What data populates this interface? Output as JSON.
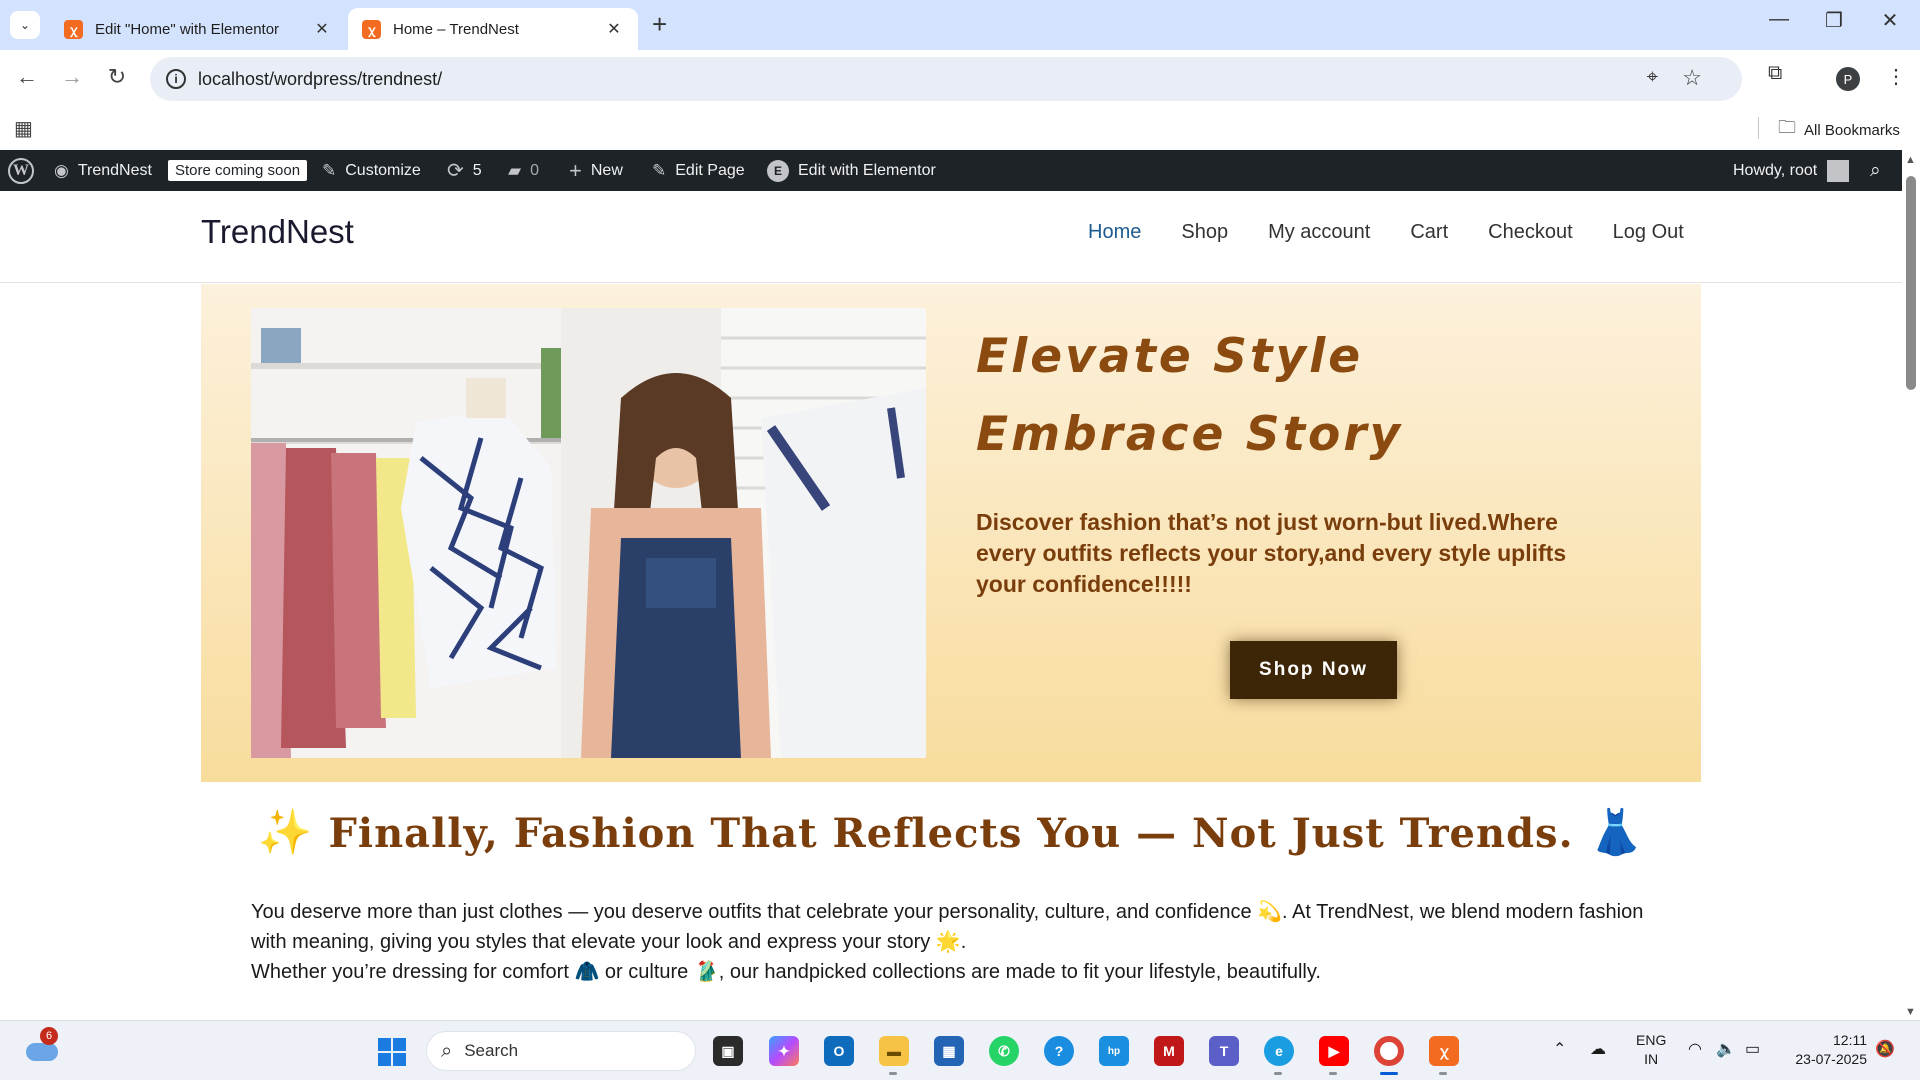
{
  "browser": {
    "tabs": [
      {
        "title": "Edit \"Home\" with Elementor",
        "active": false
      },
      {
        "title": "Home – TrendNest",
        "active": true
      }
    ],
    "url": "localhost/wordpress/trendnest/",
    "bookmarks_label": "All Bookmarks",
    "profile_initial": "P"
  },
  "adminbar": {
    "site_name": "TrendNest",
    "store_badge": "Store coming soon",
    "customize": "Customize",
    "updates_count": "5",
    "comments_count": "0",
    "new": "New",
    "edit_page": "Edit Page",
    "edit_elementor": "Edit with Elementor",
    "howdy": "Howdy, root"
  },
  "site": {
    "title": "TrendNest",
    "menu": [
      "Home",
      "Shop",
      "My account",
      "Cart",
      "Checkout",
      "Log Out"
    ],
    "current_menu": "Home"
  },
  "hero": {
    "title_line1": "Elevate  Style",
    "title_line2": "Embrace  Story",
    "description": "Discover fashion that’s not just worn-but lived.Where every outfits reflects your story,and every style uplifts your confidence!!!!!",
    "button": "Shop  Now"
  },
  "section": {
    "heading_emoji_left": "✨",
    "heading": "Finally, Fashion That Reflects You — Not Just Trends.",
    "heading_emoji_right": "👗",
    "line1_a": "You deserve more than just clothes — you deserve outfits that celebrate your personality, culture, and confidence ",
    "line1_emoji": "💫",
    "line1_b": ". At TrendNest, we blend modern fashion with meaning, giving you styles that elevate your look and express your story ",
    "line1_emoji2": "🌟",
    "line1_c": ".",
    "line2_a": "Whether you’re dressing for comfort ",
    "line2_emoji": "🧥",
    "line2_b": " or culture ",
    "line2_emoji2": "🥻",
    "line2_c": ", our handpicked collections are made to fit your lifestyle, beautifully."
  },
  "taskbar": {
    "weather_badge": "6",
    "search_placeholder": "Search",
    "lang_line1": "ENG",
    "lang_line2": "IN",
    "time": "12:11",
    "date": "23-07-2025"
  },
  "colors": {
    "accent_brown": "#7a3d0c",
    "button_bg": "#3d2607",
    "menu_current": "#1e5b8f",
    "adminbar_bg": "#1d2327"
  }
}
